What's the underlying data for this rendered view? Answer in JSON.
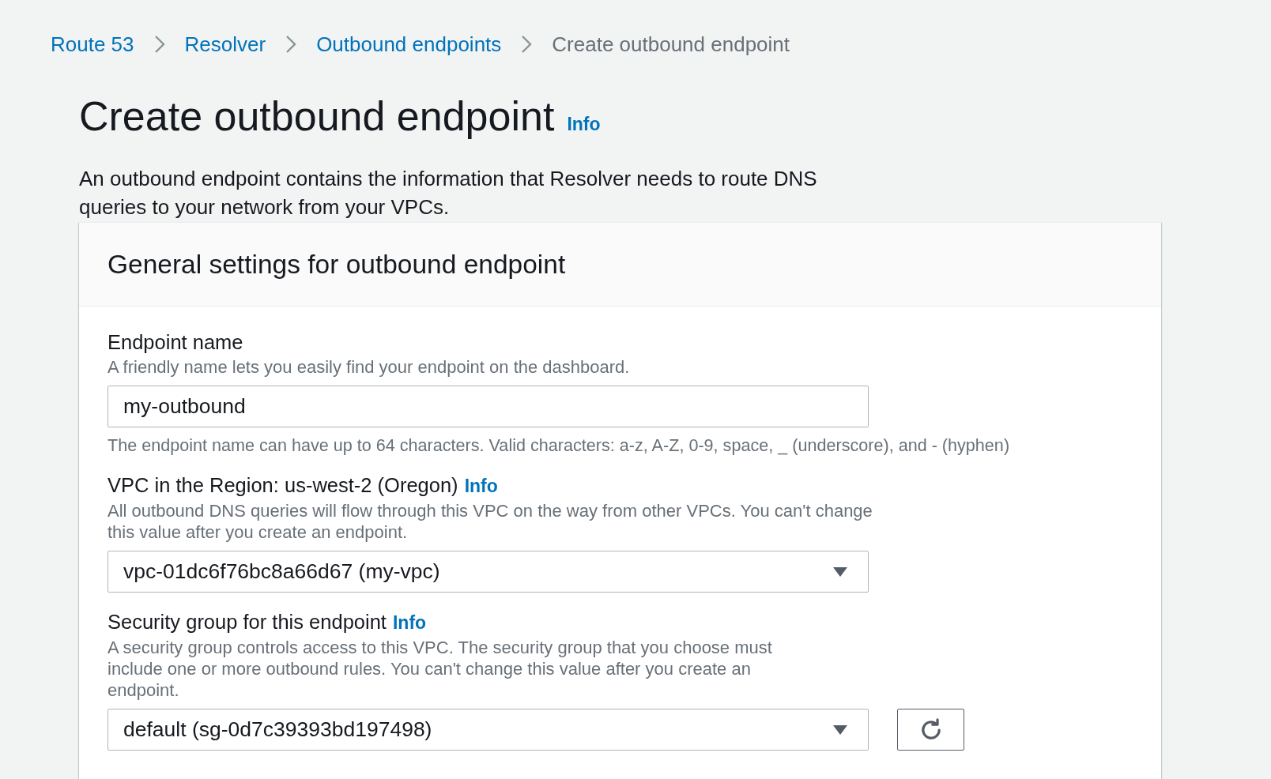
{
  "breadcrumbs": [
    {
      "label": "Route 53",
      "kind": "link"
    },
    {
      "label": "Resolver",
      "kind": "link"
    },
    {
      "label": "Outbound endpoints",
      "kind": "link"
    },
    {
      "label": "Create outbound endpoint",
      "kind": "current"
    }
  ],
  "page": {
    "title": "Create outbound endpoint",
    "info_link": "Info",
    "description": "An outbound endpoint contains the information that Resolver needs to route DNS queries to your network from your VPCs."
  },
  "card": {
    "title": "General settings for outbound endpoint",
    "fields": [
      {
        "kind": "text",
        "label": "Endpoint name",
        "description": "A friendly name lets you easily find your endpoint on the dashboard.",
        "control": {
          "value": "my-outbound"
        },
        "constraint": "The endpoint name can have up to 64 characters. Valid characters: a-z, A-Z, 0-9, space, _ (underscore), and - (hyphen)"
      },
      {
        "kind": "select",
        "label": "VPC in the Region: us-west-2 (Oregon)",
        "info_link": "Info",
        "description": "All outbound DNS queries will flow through this VPC on the way from other VPCs. You can't change this value after you create an endpoint.",
        "control": {
          "value": "vpc-01dc6f76bc8a66d67 (my-vpc)"
        }
      },
      {
        "kind": "select",
        "label": "Security group for this endpoint",
        "info_link": "Info",
        "description": "A security group controls access to this VPC. The security group that you choose must include one or more outbound rules. You can't change this value after you create an endpoint.",
        "control": {
          "value": "default (sg-0d7c39393bd197498)"
        },
        "refresh_button": true
      }
    ]
  }
}
